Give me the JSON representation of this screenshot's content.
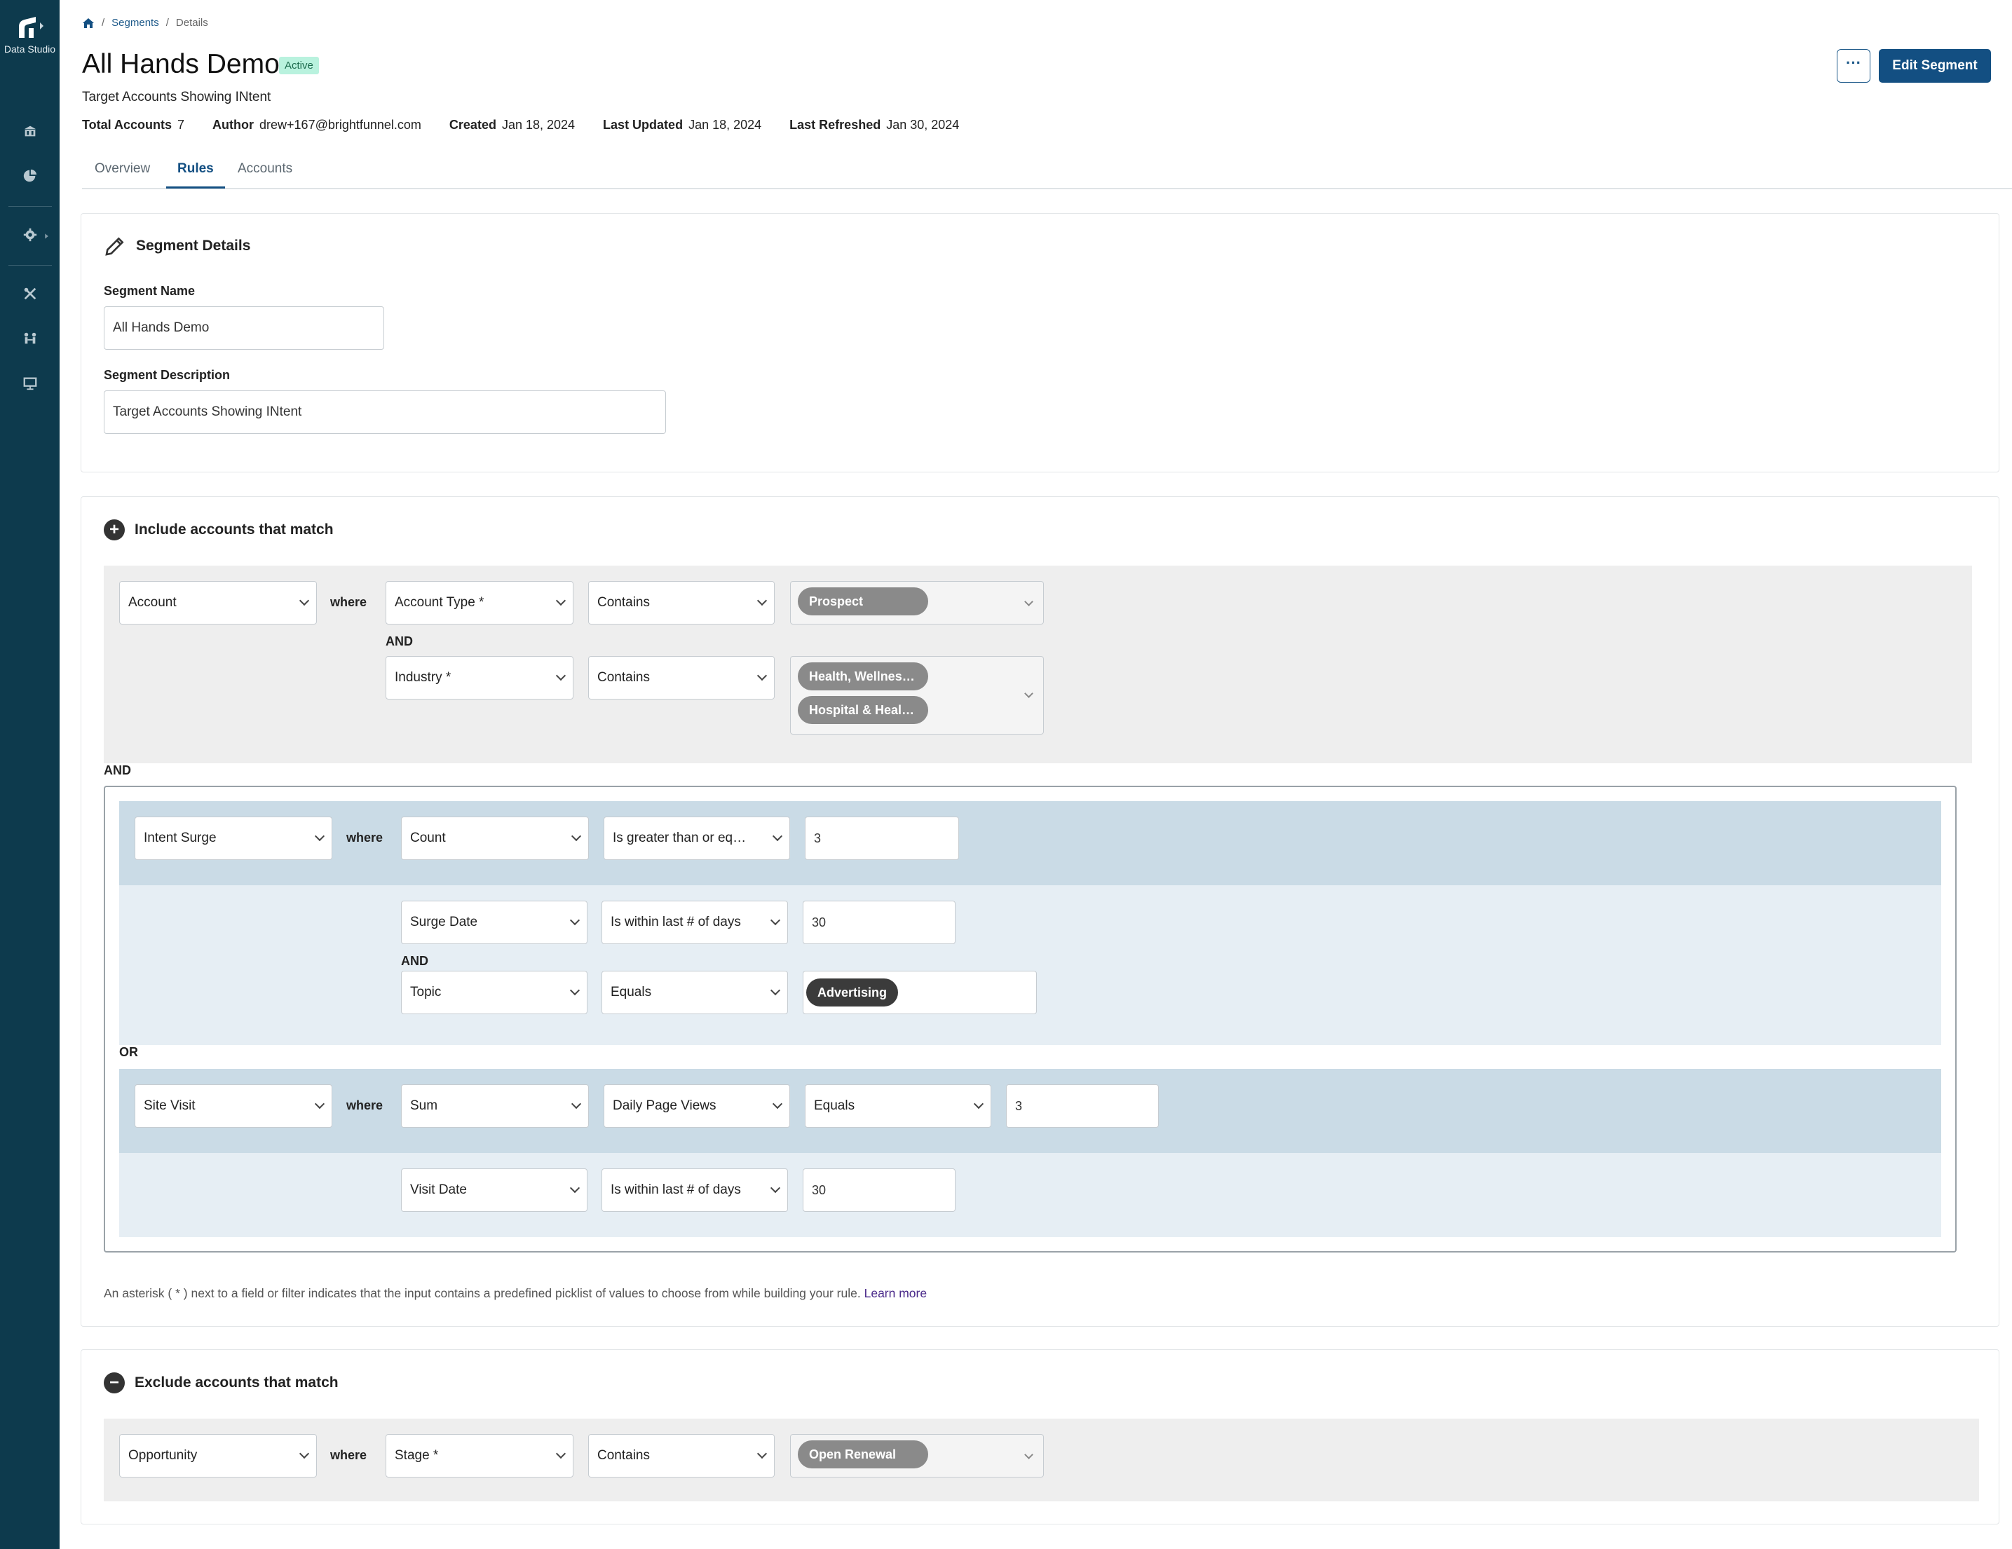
{
  "app": {
    "name": "Data Studio"
  },
  "breadcrumb": {
    "segments": "Segments",
    "details": "Details",
    "sep": "/"
  },
  "header": {
    "title": "All Hands Demo",
    "status": "Active",
    "subtitle": "Target Accounts Showing INtent",
    "more_label": "···",
    "edit_label": "Edit Segment",
    "meta": {
      "total_accounts_label": "Total Accounts",
      "total_accounts": "7",
      "author_label": "Author",
      "author": "drew+167@brightfunnel.com",
      "created_label": "Created",
      "created": "Jan 18, 2024",
      "updated_label": "Last Updated",
      "updated": "Jan 18, 2024",
      "refreshed_label": "Last Refreshed",
      "refreshed": "Jan 30, 2024"
    }
  },
  "tabs": {
    "overview": "Overview",
    "rules": "Rules",
    "accounts": "Accounts"
  },
  "details": {
    "title": "Segment Details",
    "name_label": "Segment Name",
    "name_value": "All Hands Demo",
    "desc_label": "Segment Description",
    "desc_value": "Target Accounts Showing INtent"
  },
  "include": {
    "title": "Include accounts that match",
    "icon": "+",
    "kw_where": "where",
    "kw_and": "AND",
    "kw_or": "OR",
    "account": {
      "object": "Account",
      "field1": "Account Type *",
      "op1": "Contains",
      "chips1": [
        "Prospect"
      ],
      "field2": "Industry *",
      "op2": "Contains",
      "chips2": [
        "Health, Wellness & Fitness",
        "Hospital & Health Care"
      ]
    },
    "intent": {
      "object": "Intent Surge",
      "agg": "Count",
      "op": "Is greater than or equal to",
      "value": "3",
      "f1": "Surge Date",
      "op1": "Is within last # of days",
      "v1": "30",
      "f2": "Topic",
      "op2": "Equals",
      "chip2": "Advertising"
    },
    "visit": {
      "object": "Site Visit",
      "agg": "Sum",
      "metric": "Daily Page Views",
      "op": "Equals",
      "value": "3",
      "f1": "Visit Date",
      "op1": "Is within last # of days",
      "v1": "30"
    },
    "note": "An asterisk ( * ) next to a field or filter indicates that the input contains a predefined picklist of values to choose from while building your rule.",
    "learn_more": "Learn more"
  },
  "exclude": {
    "title": "Exclude accounts that match",
    "icon": "−",
    "object": "Opportunity",
    "where": "where",
    "field": "Stage *",
    "op": "Contains",
    "chip": "Open Renewal"
  }
}
